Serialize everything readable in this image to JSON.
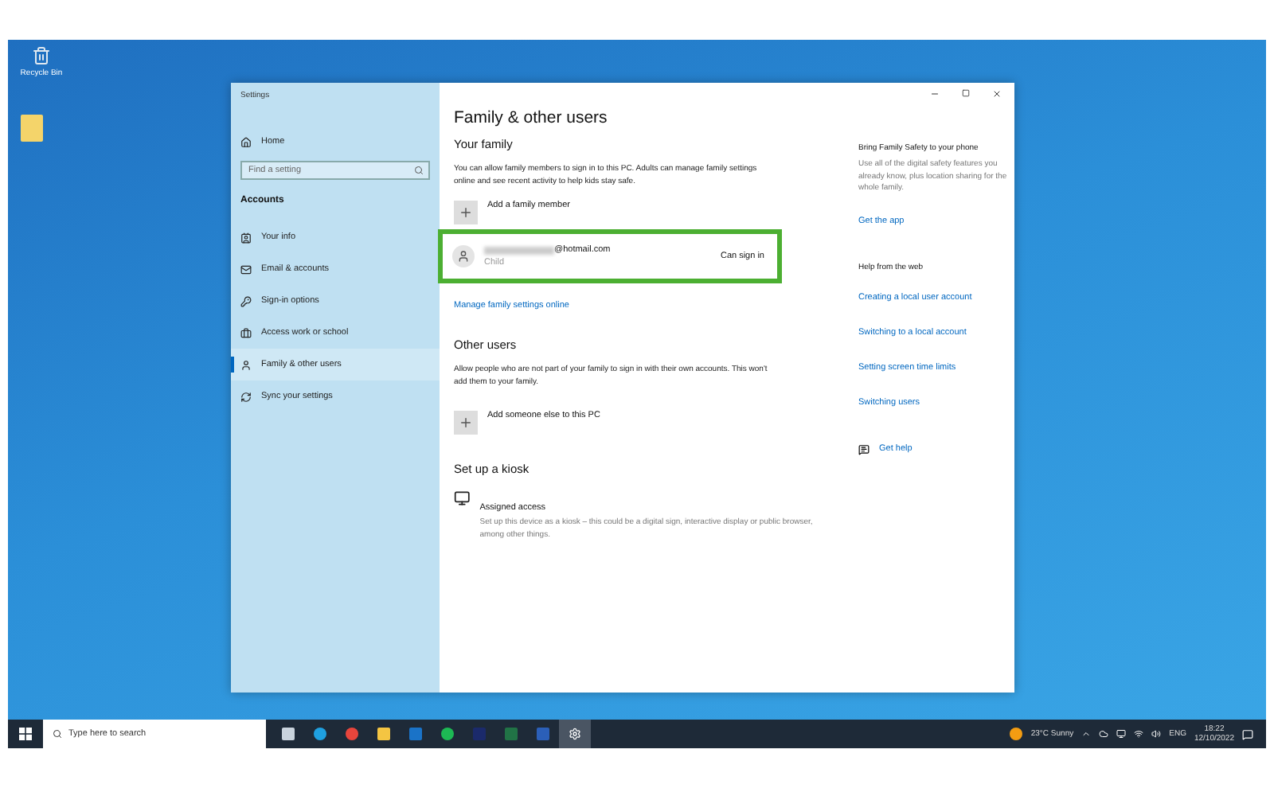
{
  "desktop_icons": [
    {
      "label": "Recycle Bin"
    }
  ],
  "window": {
    "title": "Settings"
  },
  "sidebar": {
    "home": "Home",
    "search": {
      "placeholder": "Find a setting"
    },
    "section": "Accounts",
    "items": [
      {
        "label": "Your info",
        "selected": false
      },
      {
        "label": "Email & accounts",
        "selected": false
      },
      {
        "label": "Sign-in options",
        "selected": false
      },
      {
        "label": "Access work or school",
        "selected": false
      },
      {
        "label": "Family & other users",
        "selected": true
      },
      {
        "label": "Sync your settings",
        "selected": false
      }
    ]
  },
  "main": {
    "title": "Family & other users",
    "your_family": {
      "heading": "Your family",
      "description": "You can allow family members to sign in to this PC. Adults can manage family settings online and see recent activity to help kids stay safe.",
      "add_label": "Add a family member",
      "member": {
        "email": "@hotmail.com",
        "role": "Child",
        "status": "Can sign in",
        "highlighted": true
      },
      "link": "Manage family settings online"
    },
    "other_users": {
      "heading": "Other users",
      "description": "Allow people who are not part of your family to sign in with their own accounts. This won't add them to your family.",
      "add_label": "Add someone else to this PC"
    },
    "kiosk": {
      "heading": "Set up a kiosk",
      "item_title": "Assigned access",
      "item_description": "Set up this device as a kiosk – this could be a digital sign, interactive display or public browser, among other things."
    }
  },
  "aside": {
    "phone_heading": "Bring Family Safety to your phone",
    "phone_text": "Use all of the digital safety features you already know, plus location sharing for the whole family.",
    "phone_link": "Get the app",
    "web_heading": "Help from the web",
    "links": [
      "Creating a local user account",
      "Switching to a local account",
      "Setting screen time limits",
      "Switching users"
    ],
    "help_link": "Get help"
  },
  "taskbar": {
    "search": {
      "placeholder": "Type here to search"
    },
    "apps": [
      {
        "selected": false
      },
      {
        "selected": false
      },
      {
        "selected": false
      },
      {
        "selected": false
      },
      {
        "selected": false
      },
      {
        "selected": false
      },
      {
        "selected": false
      },
      {
        "selected": false
      },
      {
        "selected": false
      },
      {
        "selected": true
      }
    ],
    "weather": "23°C Sunny",
    "language": "ENG",
    "time": "18:22",
    "date": "12/10/2022"
  }
}
